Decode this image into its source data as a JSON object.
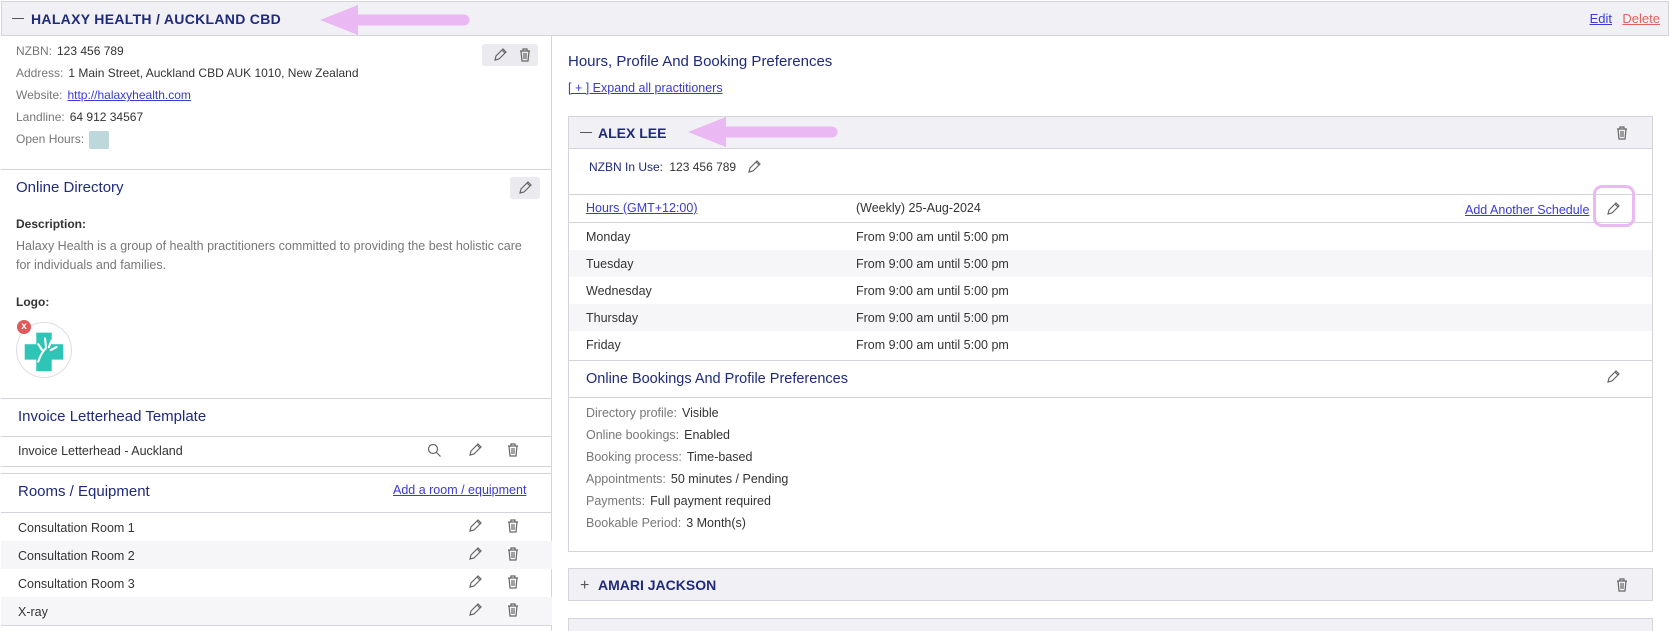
{
  "header": {
    "title": "HALAXY HEALTH / AUCKLAND CBD",
    "edit_label": "Edit",
    "delete_label": "Delete"
  },
  "org": {
    "nzbn_label": "NZBN:",
    "nzbn": "123 456 789",
    "address_label": "Address:",
    "address": "1 Main Street, Auckland CBD AUK 1010, New Zealand",
    "website_label": "Website:",
    "website": "http://halaxyhealth.com",
    "landline_label": "Landline:",
    "landline": "64 912 34567",
    "open_hours_label": "Open Hours:"
  },
  "directory": {
    "title": "Online Directory",
    "description_label": "Description:",
    "description": "Halaxy Health is a group of health practitioners committed to providing the best holistic care for individuals and families.",
    "logo_label": "Logo:",
    "logo_remove": "x"
  },
  "letterhead": {
    "title": "Invoice Letterhead Template",
    "item": "Invoice Letterhead - Auckland"
  },
  "rooms": {
    "title": "Rooms / Equipment",
    "add_link": "Add a room / equipment",
    "items": [
      "Consultation Room 1",
      "Consultation Room 2",
      "Consultation Room 3",
      "X-ray"
    ]
  },
  "right": {
    "title": "Hours, Profile And Booking Preferences",
    "expand_link": "[ + ] Expand all practitioners"
  },
  "practitioner": {
    "name": "ALEX LEE",
    "nzbn_label": "NZBN In Use:",
    "nzbn": "123 456 789",
    "hours_link": "Hours (GMT+12:00)",
    "schedule": "(Weekly) 25-Aug-2024",
    "add_schedule": "Add Another Schedule",
    "days": [
      {
        "day": "Monday",
        "hours": "From 9:00 am until 5:00 pm"
      },
      {
        "day": "Tuesday",
        "hours": "From 9:00 am until 5:00 pm"
      },
      {
        "day": "Wednesday",
        "hours": "From 9:00 am until 5:00 pm"
      },
      {
        "day": "Thursday",
        "hours": "From 9:00 am until 5:00 pm"
      },
      {
        "day": "Friday",
        "hours": "From 9:00 am until 5:00 pm"
      }
    ],
    "prefs_title": "Online Bookings And Profile Preferences",
    "prefs": [
      {
        "label": "Directory profile:",
        "value": "Visible"
      },
      {
        "label": "Online bookings:",
        "value": "Enabled"
      },
      {
        "label": "Booking process:",
        "value": "Time-based"
      },
      {
        "label": "Appointments:",
        "value": "50 minutes / Pending"
      },
      {
        "label": "Payments:",
        "value": "Full payment required"
      },
      {
        "label": "Bookable Period:",
        "value": "3 Month(s)"
      }
    ]
  },
  "practitioner2": {
    "name": "AMARI JACKSON"
  },
  "colors": {
    "navy": "#1f2a7a",
    "link": "#3a3ad6",
    "delete": "#e0625e",
    "annotation": "#eab8f2",
    "logo_teal": "#2ec4b6"
  },
  "icons": [
    "minus-icon",
    "pencil-icon",
    "trash-icon",
    "search-icon",
    "plus-icon",
    "close-icon",
    "arrow-annotation"
  ]
}
